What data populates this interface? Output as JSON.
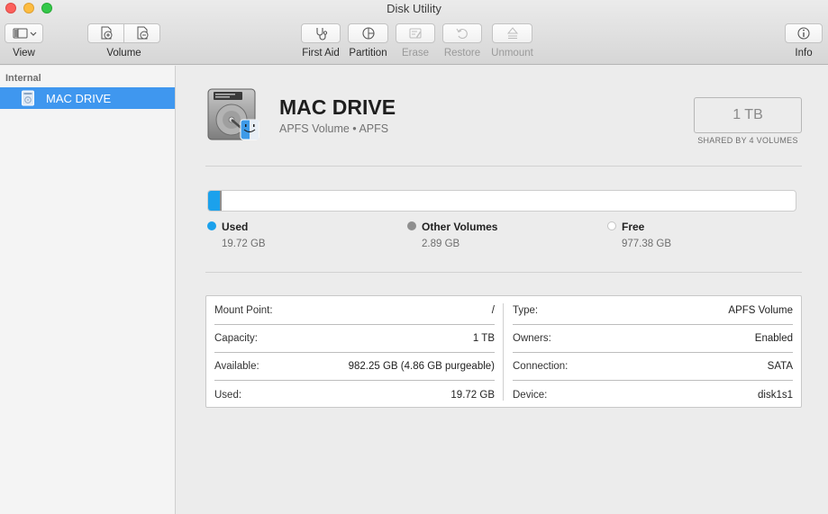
{
  "window": {
    "title": "Disk Utility"
  },
  "toolbar": {
    "view_label": "View",
    "volume_label": "Volume",
    "first_aid_label": "First Aid",
    "partition_label": "Partition",
    "erase_label": "Erase",
    "restore_label": "Restore",
    "unmount_label": "Unmount",
    "info_label": "Info"
  },
  "sidebar": {
    "section": "Internal",
    "items": [
      {
        "label": "MAC DRIVE",
        "icon": "drive-icon",
        "selected": true
      }
    ]
  },
  "volume": {
    "name": "MAC DRIVE",
    "subtitle": "APFS Volume • APFS",
    "capacity": "1 TB",
    "capacity_note": "SHARED BY 4 VOLUMES"
  },
  "usage": {
    "used_fraction": 0.0197,
    "other_fraction": 0.0029,
    "legend": [
      {
        "name": "Used",
        "value": "19.72 GB",
        "color": "#1ba1ec"
      },
      {
        "name": "Other Volumes",
        "value": "2.89 GB",
        "color": "#8f8f8f"
      },
      {
        "name": "Free",
        "value": "977.38 GB",
        "color": "#ffffff"
      }
    ]
  },
  "info": {
    "left": [
      {
        "key": "Mount Point:",
        "value": "/"
      },
      {
        "key": "Capacity:",
        "value": "1 TB"
      },
      {
        "key": "Available:",
        "value": "982.25 GB (4.86 GB purgeable)"
      },
      {
        "key": "Used:",
        "value": "19.72 GB"
      }
    ],
    "right": [
      {
        "key": "Type:",
        "value": "APFS Volume"
      },
      {
        "key": "Owners:",
        "value": "Enabled"
      },
      {
        "key": "Connection:",
        "value": "SATA"
      },
      {
        "key": "Device:",
        "value": "disk1s1"
      }
    ]
  },
  "colors": {
    "accent": "#3f97ef",
    "used": "#1ba1ec",
    "other": "#8f8f8f"
  }
}
